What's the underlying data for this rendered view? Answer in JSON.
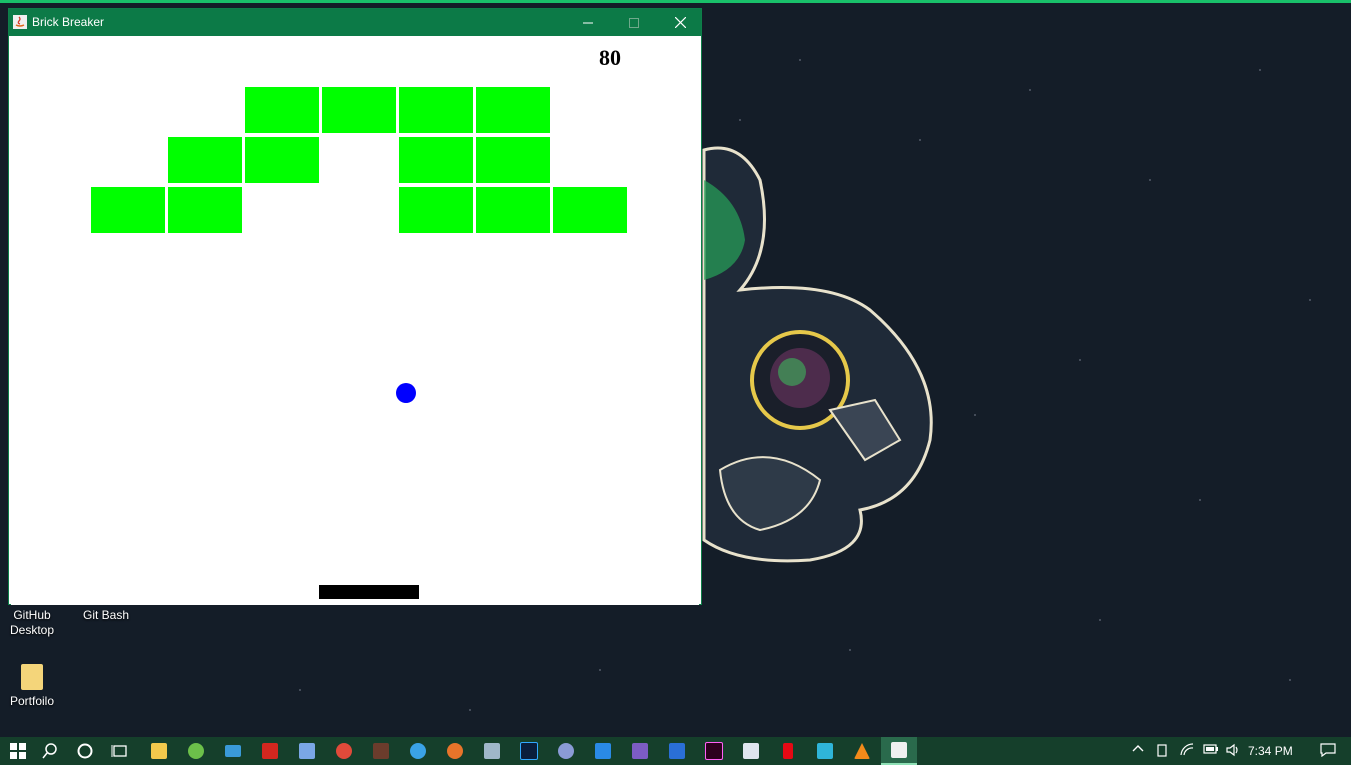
{
  "window": {
    "title": "Brick Breaker"
  },
  "game": {
    "score": "80"
  },
  "desktop_icons": [
    {
      "label": "GitHub Desktop"
    },
    {
      "label": "Git Bash"
    },
    {
      "label": "Portfoilo"
    }
  ],
  "taskbar": {
    "time": "7:34 PM"
  },
  "colors": {
    "brick": "#00ff00",
    "ball": "#0000ff",
    "paddle": "#000000",
    "titlebar": "#0c7a47",
    "taskbar": "#153f2b"
  }
}
